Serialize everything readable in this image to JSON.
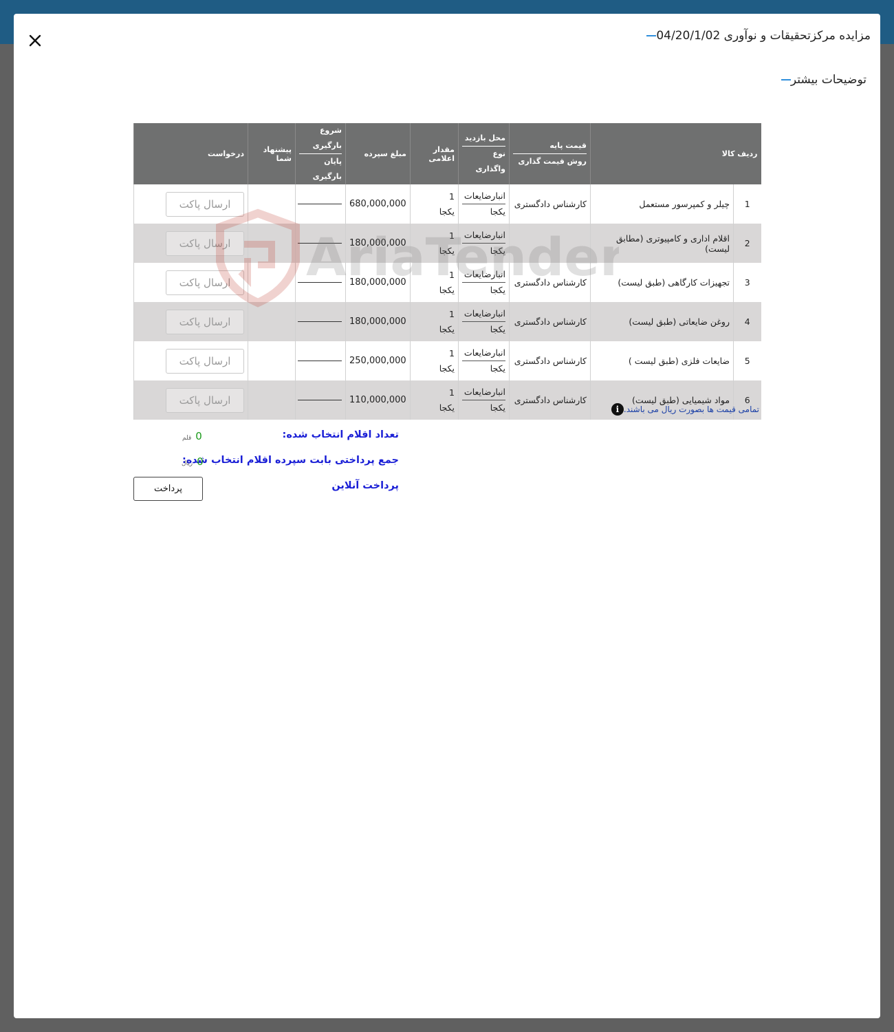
{
  "modal": {
    "title": "مزایده مرکزتحقیقات و نوآوری 04/20/1/02",
    "subtitle": "توضیحات بیشتر",
    "close_icon": "close-icon"
  },
  "table": {
    "headers": {
      "row_item": "ردیف کالا",
      "base_price": "قیمت پایه",
      "pricing_method": "روش قیمت گذاری",
      "visit_location": "محل بازدید",
      "assignment_type": "نوع واگذاری",
      "announced_qty": "مقدار اعلامی",
      "deposit_amount": "مبلغ سپرده",
      "loading_start": "شروع بارگیری",
      "loading_end": "پایان بارگیری",
      "your_offer": "پیشنهاد شما",
      "request": "درخواست"
    },
    "rows": [
      {
        "index": "1",
        "name": "چیلر و کمپرسور مستعمل",
        "pricing": "کارشناس دادگستری",
        "location": "انبارضایعات",
        "type": "یکجا",
        "qty": "1",
        "unit": "یکجا",
        "deposit": "680,000,000",
        "button": "ارسال پاکت"
      },
      {
        "index": "2",
        "name": "اقلام اداری و کامپیوتری (مطابق لیست)",
        "pricing": "",
        "location": "انبارضایعات",
        "type": "یکجا",
        "qty": "1",
        "unit": "یکجا",
        "deposit": "180,000,000",
        "button": "ارسال پاکت"
      },
      {
        "index": "3",
        "name": "تجهیزات کارگاهی (طبق لیست)",
        "pricing": "کارشناس دادگستری",
        "location": "انبارضایعات",
        "type": "یکجا",
        "qty": "1",
        "unit": "یکجا",
        "deposit": "180,000,000",
        "button": "ارسال پاکت"
      },
      {
        "index": "4",
        "name": "روغن ضایعاتی (طبق لیست)",
        "pricing": "کارشناس دادگستری",
        "location": "انبارضایعات",
        "type": "یکجا",
        "qty": "1",
        "unit": "یکجا",
        "deposit": "180,000,000",
        "button": "ارسال پاکت"
      },
      {
        "index": "5",
        "name": "ضایعات فلزی (طبق لیست )",
        "pricing": "کارشناس دادگستری",
        "location": "انبارضایعات",
        "type": "یکجا",
        "qty": "1",
        "unit": "یکجا",
        "deposit": "250,000,000",
        "button": "ارسال پاکت"
      },
      {
        "index": "6",
        "name": "مواد شیمیایی (طبق لیست)",
        "pricing": "کارشناس دادگستری",
        "location": "انبارضایعات",
        "type": "یکجا",
        "qty": "1",
        "unit": "یکجا",
        "deposit": "110,000,000",
        "button": "ارسال پاکت"
      }
    ]
  },
  "note": {
    "text": "تمامی قیمت ها بصورت ریال می باشند.",
    "icon": "info-icon"
  },
  "summary": {
    "selected_count_label": "تعداد اقلام انتخاب شده:",
    "selected_count_value": "0",
    "selected_count_unit": "قلم",
    "total_payment_label": "جمع پرداختی بابت سپرده اقلام انتخاب شده:",
    "total_payment_value": "0",
    "total_payment_unit": "ریال",
    "online_payment_label": "پرداخت آنلاین",
    "pay_button": "پرداخت"
  },
  "watermark": {
    "text": "AriaTender.neT"
  },
  "colors": {
    "topbar": "#1f5c84",
    "overlay": "#606060",
    "header_bg": "#6f7070",
    "accent_dash": "#2f8fdc",
    "summary_blue": "#1a1fd6",
    "value_green": "#1b9a1b"
  }
}
